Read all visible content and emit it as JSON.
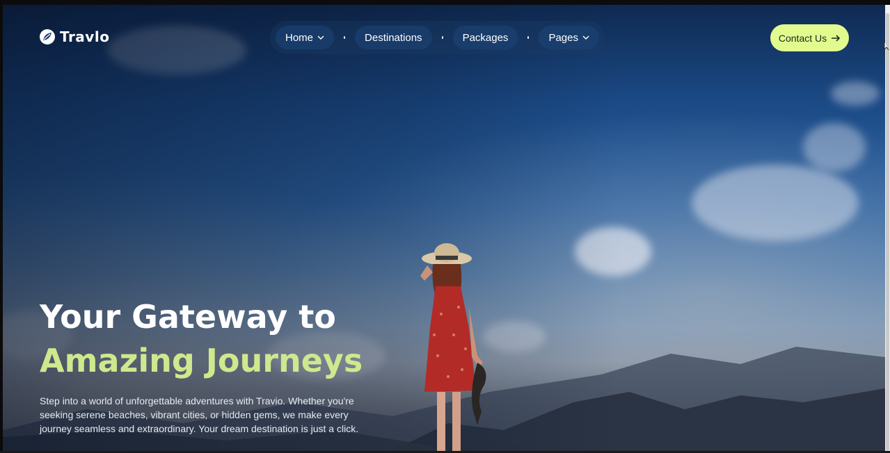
{
  "brand": {
    "name": "Travlo",
    "logo_icon": "leaf-icon"
  },
  "nav": {
    "items": [
      {
        "label": "Home",
        "has_dropdown": true
      },
      {
        "label": "Destinations",
        "has_dropdown": false
      },
      {
        "label": "Packages",
        "has_dropdown": false
      },
      {
        "label": "Pages",
        "has_dropdown": true
      }
    ],
    "contact_label": "Contact Us"
  },
  "hero": {
    "headline_line1": "Your Gateway to",
    "headline_line2": "Amazing Journeys",
    "subcopy": "Step into a world of unforgettable adventures with Travio. Whether you're seeking serene beaches, vibrant cities, or hidden gems, we make every journey seamless and extraordinary. Your dream destination is just a click."
  },
  "colors": {
    "accent": "#e2fb8e",
    "headline_accent": "#cfe88e",
    "sky_dark": "#0f2a52"
  }
}
